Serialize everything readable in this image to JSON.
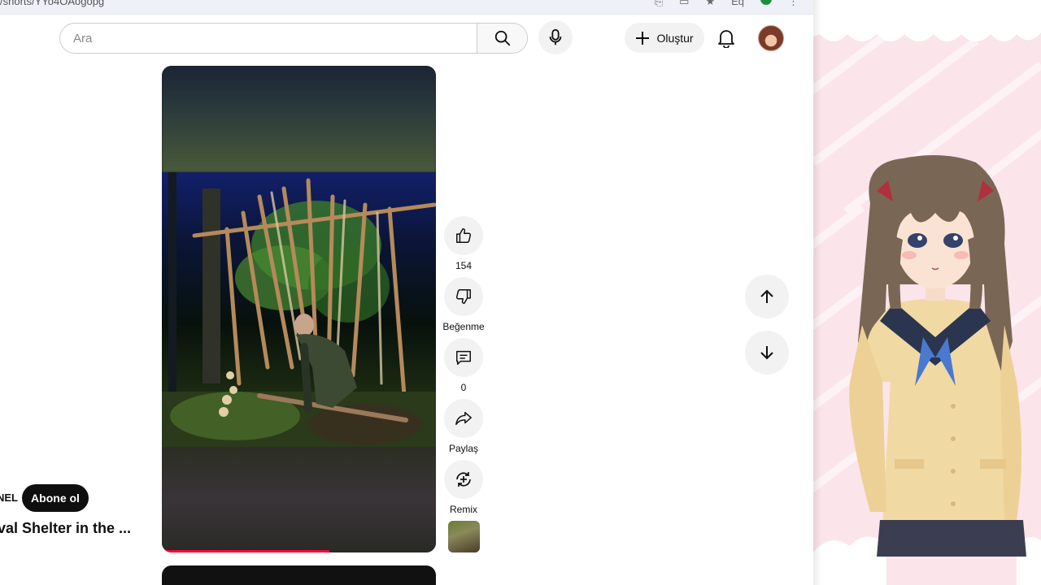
{
  "browser": {
    "url": "/shorts/YYo4OAogopg",
    "zoom": "Eq"
  },
  "header": {
    "search_placeholder": "Ara",
    "create_label": "Oluştur"
  },
  "shorts": {
    "progress_fraction": 0.61,
    "actions": {
      "like_count": "154",
      "dislike_label": "Beğenme",
      "comment_count": "0",
      "share_label": "Paylaş",
      "remix_label": "Remix"
    },
    "channel_name_fragment": "NEL",
    "subscribe_label": "Abone ol",
    "title_fragment": "val Shelter in the ..."
  },
  "colors": {
    "accent": "#ff0033",
    "overlay_bg": "#fbe4ea"
  },
  "icons": [
    "search-icon",
    "mic-icon",
    "plus-icon",
    "bell-icon",
    "thumbs-up-icon",
    "thumbs-down-icon",
    "comment-icon",
    "share-icon",
    "remix-icon",
    "arrow-up-icon",
    "arrow-down-icon"
  ]
}
